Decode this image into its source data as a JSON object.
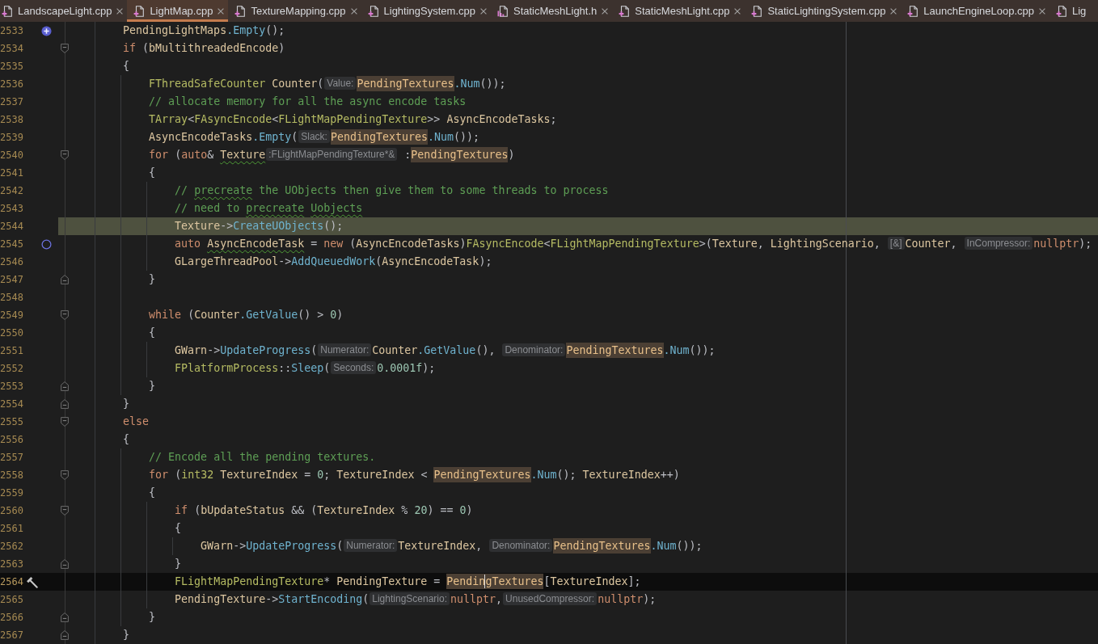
{
  "tabs": [
    {
      "label": "LandscapeLight.cpp",
      "kind": "cpp",
      "selected": false,
      "close_button": true
    },
    {
      "label": "LightMap.cpp",
      "kind": "cpp",
      "selected": true,
      "close_button": true
    },
    {
      "label": "TextureMapping.cpp",
      "kind": "cpp",
      "selected": false,
      "close_button": true
    },
    {
      "label": "LightingSystem.cpp",
      "kind": "cpp",
      "selected": false,
      "close_button": true
    },
    {
      "label": "StaticMeshLight.h",
      "kind": "h",
      "selected": false,
      "close_button": true
    },
    {
      "label": "StaticMeshLight.cpp",
      "kind": "cpp",
      "selected": false,
      "close_button": true
    },
    {
      "label": "StaticLightingSystem.cpp",
      "kind": "cpp",
      "selected": false,
      "close_button": true
    },
    {
      "label": "LaunchEngineLoop.cpp",
      "kind": "cpp",
      "selected": false,
      "close_button": true
    },
    {
      "label": "Lig",
      "kind": "cpp",
      "selected": false,
      "close_button": false
    }
  ],
  "editor": {
    "lines": [
      {
        "number": "2533",
        "highlighted": false,
        "current": false,
        "gutter_icon": {
          "kind": "plus"
        },
        "code": [
          {
            "kind": "id",
            "text": "        PendingLightMaps"
          },
          {
            "kind": "fn",
            "text": ".Empty"
          },
          {
            "kind": "p",
            "text": "();"
          }
        ]
      },
      {
        "number": "2534",
        "highlighted": false,
        "current": false,
        "fold_marker": {
          "kind": "start"
        },
        "code": [
          {
            "kind": "kw",
            "text": "        if"
          },
          {
            "kind": "p",
            "text": " ("
          },
          {
            "kind": "id",
            "text": "bMultithreadedEncode"
          },
          {
            "kind": "p",
            "text": ")"
          }
        ]
      },
      {
        "number": "2535",
        "highlighted": false,
        "current": false,
        "code": [
          {
            "kind": "p",
            "text": "        {"
          }
        ]
      },
      {
        "number": "2536",
        "highlighted": false,
        "current": false,
        "code": [
          {
            "kind": "type",
            "text": "            FThreadSafeCounter"
          },
          {
            "kind": "id",
            "text": " Counter"
          },
          {
            "kind": "p",
            "text": "("
          },
          {
            "kind": "hint",
            "text": "Value:"
          },
          {
            "kind": "match",
            "text": "PendingTextures"
          },
          {
            "kind": "fn",
            "text": ".Num"
          },
          {
            "kind": "p",
            "text": "());"
          }
        ]
      },
      {
        "number": "2537",
        "highlighted": false,
        "current": false,
        "code": [
          {
            "kind": "cm",
            "text": "            // allocate memory for all the async encode tasks"
          }
        ]
      },
      {
        "number": "2538",
        "highlighted": false,
        "current": false,
        "code": [
          {
            "kind": "type",
            "text": "            TArray"
          },
          {
            "kind": "p",
            "text": "<"
          },
          {
            "kind": "type",
            "text": "FAsyncEncode"
          },
          {
            "kind": "p",
            "text": "<"
          },
          {
            "kind": "type",
            "text": "FLightMapPendingTexture"
          },
          {
            "kind": "p",
            "text": ">> "
          },
          {
            "kind": "id",
            "text": "AsyncEncodeTasks"
          },
          {
            "kind": "p",
            "text": ";"
          }
        ]
      },
      {
        "number": "2539",
        "highlighted": false,
        "current": false,
        "code": [
          {
            "kind": "id",
            "text": "            AsyncEncodeTasks"
          },
          {
            "kind": "fn",
            "text": ".Empty"
          },
          {
            "kind": "p",
            "text": "("
          },
          {
            "kind": "hint",
            "text": "Slack:"
          },
          {
            "kind": "match",
            "text": "PendingTextures"
          },
          {
            "kind": "fn",
            "text": ".Num"
          },
          {
            "kind": "p",
            "text": "());"
          }
        ]
      },
      {
        "number": "2540",
        "highlighted": false,
        "current": false,
        "fold_marker": {
          "kind": "start"
        },
        "code": [
          {
            "kind": "kw",
            "text": "            for"
          },
          {
            "kind": "p",
            "text": " ("
          },
          {
            "kind": "kw",
            "text": "auto"
          },
          {
            "kind": "p",
            "text": "& "
          },
          {
            "kind": "id_warn",
            "text": "Texture"
          },
          {
            "kind": "hint",
            "text": ":FLightMapPendingTexture*&"
          },
          {
            "kind": "p",
            "text": " :"
          },
          {
            "kind": "match",
            "text": "PendingTextures"
          },
          {
            "kind": "p",
            "text": ")"
          }
        ]
      },
      {
        "number": "2541",
        "highlighted": false,
        "current": false,
        "code": [
          {
            "kind": "p",
            "text": "            {"
          }
        ]
      },
      {
        "number": "2542",
        "highlighted": false,
        "current": false,
        "code": [
          {
            "kind": "cm",
            "text": "                // "
          },
          {
            "kind": "cm_warn",
            "text": "precreate"
          },
          {
            "kind": "cm",
            "text": " the UObjects then give them to some threads to process"
          }
        ]
      },
      {
        "number": "2543",
        "highlighted": false,
        "current": false,
        "code": [
          {
            "kind": "cm",
            "text": "                // need to "
          },
          {
            "kind": "cm_warn",
            "text": "precreate"
          },
          {
            "kind": "cm_warn",
            "text": " Uobjects"
          }
        ]
      },
      {
        "number": "2544",
        "highlighted": true,
        "current": false,
        "code": [
          {
            "kind": "id",
            "text": "                Texture"
          },
          {
            "kind": "p",
            "text": "->"
          },
          {
            "kind": "fn",
            "text": "CreateUObjects"
          },
          {
            "kind": "p",
            "text": "();"
          }
        ]
      },
      {
        "number": "2545",
        "highlighted": false,
        "current": false,
        "gutter_icon": {
          "kind": "circle"
        },
        "code": [
          {
            "kind": "kw",
            "text": "                auto"
          },
          {
            "kind": "id_warn",
            "text": " AsyncEncodeTask"
          },
          {
            "kind": "p",
            "text": " = "
          },
          {
            "kind": "kw",
            "text": "new"
          },
          {
            "kind": "p",
            "text": " ("
          },
          {
            "kind": "id",
            "text": "AsyncEncodeTasks"
          },
          {
            "kind": "p",
            "text": ")"
          },
          {
            "kind": "type",
            "text": "FAsyncEncode"
          },
          {
            "kind": "p",
            "text": "<"
          },
          {
            "kind": "type",
            "text": "FLightMapPendingTexture"
          },
          {
            "kind": "p",
            "text": ">("
          },
          {
            "kind": "id",
            "text": "Texture"
          },
          {
            "kind": "p",
            "text": ", "
          },
          {
            "kind": "id",
            "text": "LightingScenario"
          },
          {
            "kind": "p",
            "text": ", "
          },
          {
            "kind": "hint",
            "text": "[&]"
          },
          {
            "kind": "id",
            "text": "Counter"
          },
          {
            "kind": "p",
            "text": ", "
          },
          {
            "kind": "hint",
            "text": "InCompressor:"
          },
          {
            "kind": "kw",
            "text": "nullptr"
          },
          {
            "kind": "p",
            "text": ");"
          }
        ]
      },
      {
        "number": "2546",
        "highlighted": false,
        "current": false,
        "code": [
          {
            "kind": "id",
            "text": "                GLargeThreadPool"
          },
          {
            "kind": "p",
            "text": "->"
          },
          {
            "kind": "fn",
            "text": "AddQueuedWork"
          },
          {
            "kind": "p",
            "text": "("
          },
          {
            "kind": "id",
            "text": "AsyncEncodeTask"
          },
          {
            "kind": "p",
            "text": ");"
          }
        ]
      },
      {
        "number": "2547",
        "highlighted": false,
        "current": false,
        "fold_marker": {
          "kind": "end"
        },
        "code": [
          {
            "kind": "p",
            "text": "            }"
          }
        ]
      },
      {
        "number": "2548",
        "highlighted": false,
        "current": false
      },
      {
        "number": "2549",
        "highlighted": false,
        "current": false,
        "fold_marker": {
          "kind": "start"
        },
        "code": [
          {
            "kind": "kw",
            "text": "            while"
          },
          {
            "kind": "p",
            "text": " ("
          },
          {
            "kind": "id",
            "text": "Counter"
          },
          {
            "kind": "fn",
            "text": ".GetValue"
          },
          {
            "kind": "p",
            "text": "() > "
          },
          {
            "kind": "num",
            "text": "0"
          },
          {
            "kind": "p",
            "text": ")"
          }
        ]
      },
      {
        "number": "2550",
        "highlighted": false,
        "current": false,
        "code": [
          {
            "kind": "p",
            "text": "            {"
          }
        ]
      },
      {
        "number": "2551",
        "highlighted": false,
        "current": false,
        "code": [
          {
            "kind": "id",
            "text": "                GWarn"
          },
          {
            "kind": "p",
            "text": "->"
          },
          {
            "kind": "fn",
            "text": "UpdateProgress"
          },
          {
            "kind": "p",
            "text": "("
          },
          {
            "kind": "hint",
            "text": "Numerator:"
          },
          {
            "kind": "id",
            "text": "Counter"
          },
          {
            "kind": "fn",
            "text": ".GetValue"
          },
          {
            "kind": "p",
            "text": "(), "
          },
          {
            "kind": "hint",
            "text": "Denominator:"
          },
          {
            "kind": "match",
            "text": "PendingTextures"
          },
          {
            "kind": "fn",
            "text": ".Num"
          },
          {
            "kind": "p",
            "text": "());"
          }
        ]
      },
      {
        "number": "2552",
        "highlighted": false,
        "current": false,
        "code": [
          {
            "kind": "type",
            "text": "                FPlatformProcess"
          },
          {
            "kind": "p",
            "text": "::"
          },
          {
            "kind": "fn",
            "text": "Sleep"
          },
          {
            "kind": "p",
            "text": "("
          },
          {
            "kind": "hint",
            "text": "Seconds:"
          },
          {
            "kind": "num",
            "text": "0.0001f"
          },
          {
            "kind": "p",
            "text": ");"
          }
        ]
      },
      {
        "number": "2553",
        "highlighted": false,
        "current": false,
        "fold_marker": {
          "kind": "end"
        },
        "code": [
          {
            "kind": "p",
            "text": "            }"
          }
        ]
      },
      {
        "number": "2554",
        "highlighted": false,
        "current": false,
        "fold_marker": {
          "kind": "end"
        },
        "code": [
          {
            "kind": "p",
            "text": "        }"
          }
        ]
      },
      {
        "number": "2555",
        "highlighted": false,
        "current": false,
        "fold_marker": {
          "kind": "start"
        },
        "code": [
          {
            "kind": "kw",
            "text": "        else"
          }
        ]
      },
      {
        "number": "2556",
        "highlighted": false,
        "current": false,
        "code": [
          {
            "kind": "p",
            "text": "        {"
          }
        ]
      },
      {
        "number": "2557",
        "highlighted": false,
        "current": false,
        "code": [
          {
            "kind": "cm",
            "text": "            // Encode all the pending textures."
          }
        ]
      },
      {
        "number": "2558",
        "highlighted": false,
        "current": false,
        "fold_marker": {
          "kind": "start"
        },
        "code": [
          {
            "kind": "kw",
            "text": "            for"
          },
          {
            "kind": "p",
            "text": " ("
          },
          {
            "kind": "type",
            "text": "int32"
          },
          {
            "kind": "id",
            "text": " TextureIndex"
          },
          {
            "kind": "p",
            "text": " = "
          },
          {
            "kind": "num",
            "text": "0"
          },
          {
            "kind": "p",
            "text": "; "
          },
          {
            "kind": "id",
            "text": "TextureIndex"
          },
          {
            "kind": "p",
            "text": " < "
          },
          {
            "kind": "match",
            "text": "PendingTextures"
          },
          {
            "kind": "fn",
            "text": ".Num"
          },
          {
            "kind": "p",
            "text": "(); "
          },
          {
            "kind": "id",
            "text": "TextureIndex"
          },
          {
            "kind": "p",
            "text": "++)"
          }
        ]
      },
      {
        "number": "2559",
        "highlighted": false,
        "current": false,
        "code": [
          {
            "kind": "p",
            "text": "            {"
          }
        ]
      },
      {
        "number": "2560",
        "highlighted": false,
        "current": false,
        "fold_marker": {
          "kind": "start"
        },
        "code": [
          {
            "kind": "kw",
            "text": "                if"
          },
          {
            "kind": "p",
            "text": " ("
          },
          {
            "kind": "id",
            "text": "bUpdateStatus"
          },
          {
            "kind": "p",
            "text": " && ("
          },
          {
            "kind": "id",
            "text": "TextureIndex"
          },
          {
            "kind": "p",
            "text": " % "
          },
          {
            "kind": "num",
            "text": "20"
          },
          {
            "kind": "p",
            "text": ") == "
          },
          {
            "kind": "num",
            "text": "0"
          },
          {
            "kind": "p",
            "text": ")"
          }
        ]
      },
      {
        "number": "2561",
        "highlighted": false,
        "current": false,
        "code": [
          {
            "kind": "p",
            "text": "                {"
          }
        ]
      },
      {
        "number": "2562",
        "highlighted": false,
        "current": false,
        "code": [
          {
            "kind": "id",
            "text": "                    GWarn"
          },
          {
            "kind": "p",
            "text": "->"
          },
          {
            "kind": "fn",
            "text": "UpdateProgress"
          },
          {
            "kind": "p",
            "text": "("
          },
          {
            "kind": "hint",
            "text": "Numerator:"
          },
          {
            "kind": "id",
            "text": "TextureIndex"
          },
          {
            "kind": "p",
            "text": ", "
          },
          {
            "kind": "hint",
            "text": "Denominator:"
          },
          {
            "kind": "match",
            "text": "PendingTextures"
          },
          {
            "kind": "fn",
            "text": ".Num"
          },
          {
            "kind": "p",
            "text": "());"
          }
        ]
      },
      {
        "number": "2563",
        "highlighted": false,
        "current": false,
        "fold_marker": {
          "kind": "end"
        },
        "code": [
          {
            "kind": "p",
            "text": "                }"
          }
        ]
      },
      {
        "number": "2564",
        "highlighted": false,
        "current": true,
        "gutter_icon": {
          "kind": "hammer"
        },
        "code": [
          {
            "kind": "type",
            "text": "                FLightMapPendingTexture"
          },
          {
            "kind": "p",
            "text": "* "
          },
          {
            "kind": "id",
            "text": "PendingTexture"
          },
          {
            "kind": "p",
            "text": " = "
          },
          {
            "kind": "match",
            "text": "Pendin"
          },
          {
            "kind": "caret"
          },
          {
            "kind": "match",
            "text": "gTextures"
          },
          {
            "kind": "p",
            "text": "["
          },
          {
            "kind": "id",
            "text": "TextureIndex"
          },
          {
            "kind": "p",
            "text": "];"
          }
        ]
      },
      {
        "number": "2565",
        "highlighted": false,
        "current": false,
        "code": [
          {
            "kind": "id",
            "text": "                PendingTexture"
          },
          {
            "kind": "p",
            "text": "->"
          },
          {
            "kind": "fn",
            "text": "StartEncoding"
          },
          {
            "kind": "p",
            "text": "("
          },
          {
            "kind": "hint",
            "text": "LightingScenario:"
          },
          {
            "kind": "kw",
            "text": "nullptr"
          },
          {
            "kind": "p",
            "text": ","
          },
          {
            "kind": "hint",
            "text": "UnusedCompressor:"
          },
          {
            "kind": "kw",
            "text": "nullptr"
          },
          {
            "kind": "p",
            "text": ");"
          }
        ]
      },
      {
        "number": "2566",
        "highlighted": false,
        "current": false,
        "fold_marker": {
          "kind": "end"
        },
        "code": [
          {
            "kind": "p",
            "text": "            }"
          }
        ]
      },
      {
        "number": "2567",
        "highlighted": false,
        "current": false,
        "fold_marker": {
          "kind": "end"
        },
        "code": [
          {
            "kind": "p",
            "text": "        }"
          }
        ]
      }
    ]
  }
}
